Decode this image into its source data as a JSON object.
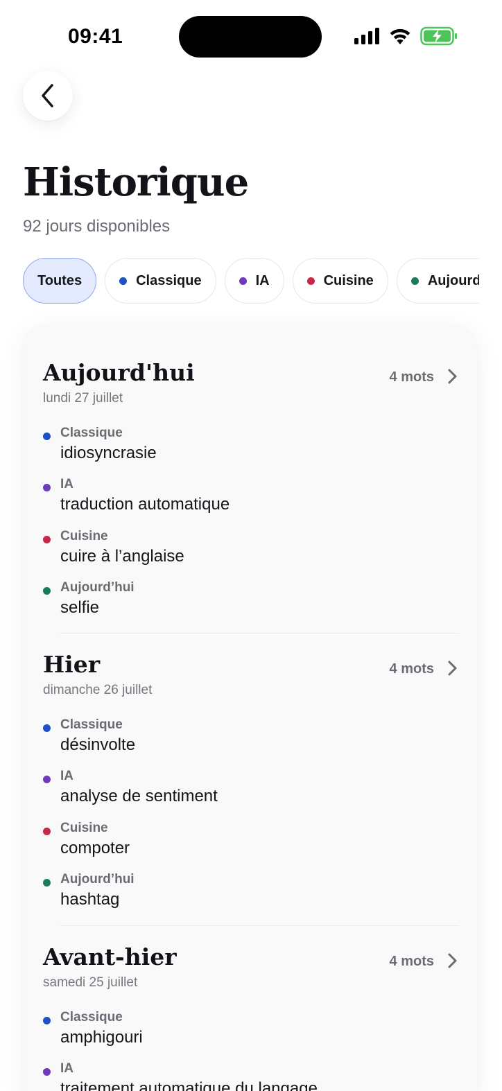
{
  "status": {
    "time": "09:41"
  },
  "colors": {
    "classique": "#1f4fc4",
    "ia": "#6e3bb8",
    "cuisine": "#c42a48",
    "aujourdhui": "#1d7a5c",
    "battery": "#4bc458"
  },
  "icons": {
    "back": "chevron-left-icon",
    "row_chevron": "chevron-right-icon",
    "signal": "cellular-signal-icon",
    "wifi": "wifi-icon",
    "battery": "battery-charging-icon"
  },
  "header": {
    "title": "Historique",
    "subtitle": "92 jours disponibles"
  },
  "filters": [
    {
      "label": "Toutes",
      "active": true
    },
    {
      "label": "Classique",
      "color": "#1f4fc4"
    },
    {
      "label": "IA",
      "color": "#6e3bb8"
    },
    {
      "label": "Cuisine",
      "color": "#c42a48"
    },
    {
      "label": "Aujourd’",
      "color": "#1d7a5c"
    }
  ],
  "days": [
    {
      "title": "Aujourd'hui",
      "date": "lundi 27 juillet",
      "count": "4 mots",
      "entries": [
        {
          "category": "Classique",
          "word": "idiosyncrasie"
        },
        {
          "category": "IA",
          "word": "traduction automatique"
        },
        {
          "category": "Cuisine",
          "word": "cuire à l’anglaise"
        },
        {
          "category": "Aujourd’hui",
          "word": "selfie"
        }
      ]
    },
    {
      "title": "Hier",
      "date": "dimanche 26 juillet",
      "count": "4 mots",
      "entries": [
        {
          "category": "Classique",
          "word": "désinvolte"
        },
        {
          "category": "IA",
          "word": "analyse de sentiment"
        },
        {
          "category": "Cuisine",
          "word": "compoter"
        },
        {
          "category": "Aujourd’hui",
          "word": "hashtag"
        }
      ]
    },
    {
      "title": "Avant-hier",
      "date": "samedi 25 juillet",
      "count": "4 mots",
      "entries": [
        {
          "category": "Classique",
          "word": "amphigouri"
        },
        {
          "category": "IA",
          "word": "traitement automatique du langage"
        }
      ]
    }
  ]
}
